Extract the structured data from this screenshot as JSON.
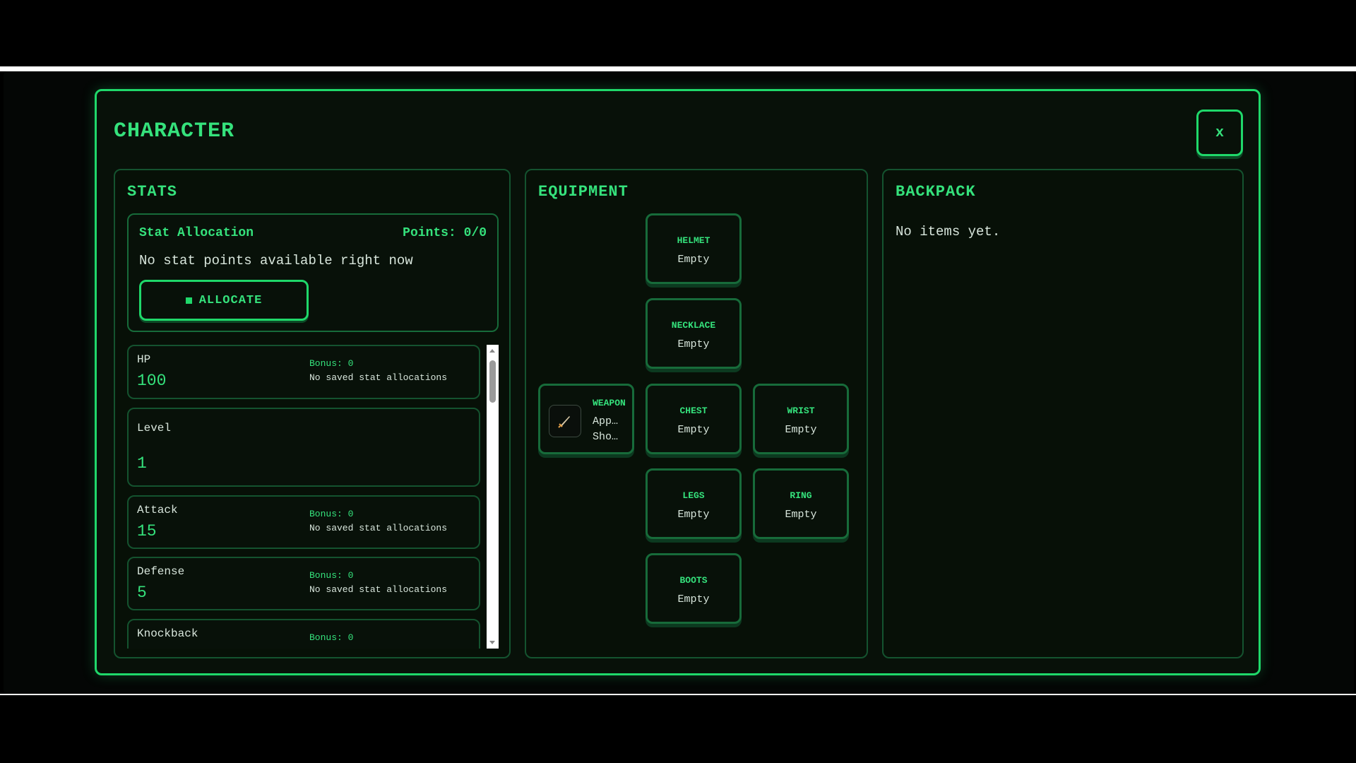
{
  "modal": {
    "title": "CHARACTER",
    "close_label": "x"
  },
  "stats": {
    "title": "STATS",
    "allocation": {
      "title": "Stat Allocation",
      "points": "Points: 0/0",
      "message": "No stat points available right now",
      "button_label": "ALLOCATE"
    },
    "items": [
      {
        "label": "HP",
        "value": "100",
        "bonus": "Bonus: 0",
        "note": "No saved stat allocations"
      },
      {
        "label": "Level",
        "value": "1"
      },
      {
        "label": "Attack",
        "value": "15",
        "bonus": "Bonus: 0",
        "note": "No saved stat allocations"
      },
      {
        "label": "Defense",
        "value": "5",
        "bonus": "Bonus: 0",
        "note": "No saved stat allocations"
      },
      {
        "label": "Knockback",
        "bonus": "Bonus: 0"
      }
    ]
  },
  "equipment": {
    "title": "EQUIPMENT",
    "slots": {
      "helmet": {
        "name": "HELMET",
        "state": "Empty"
      },
      "necklace": {
        "name": "NECKLACE",
        "state": "Empty"
      },
      "weapon": {
        "name": "WEAPON",
        "line1": "App…",
        "line2": "Sho…",
        "icon": "sword-icon"
      },
      "chest": {
        "name": "CHEST",
        "state": "Empty"
      },
      "wrist": {
        "name": "WRIST",
        "state": "Empty"
      },
      "legs": {
        "name": "LEGS",
        "state": "Empty"
      },
      "ring": {
        "name": "RING",
        "state": "Empty"
      },
      "boots": {
        "name": "BOOTS",
        "state": "Empty"
      }
    }
  },
  "backpack": {
    "title": "BACKPACK",
    "empty_message": "No items yet."
  },
  "colors": {
    "accent": "#1fd86a",
    "text_accent": "#35e27c",
    "background": "#081109"
  }
}
